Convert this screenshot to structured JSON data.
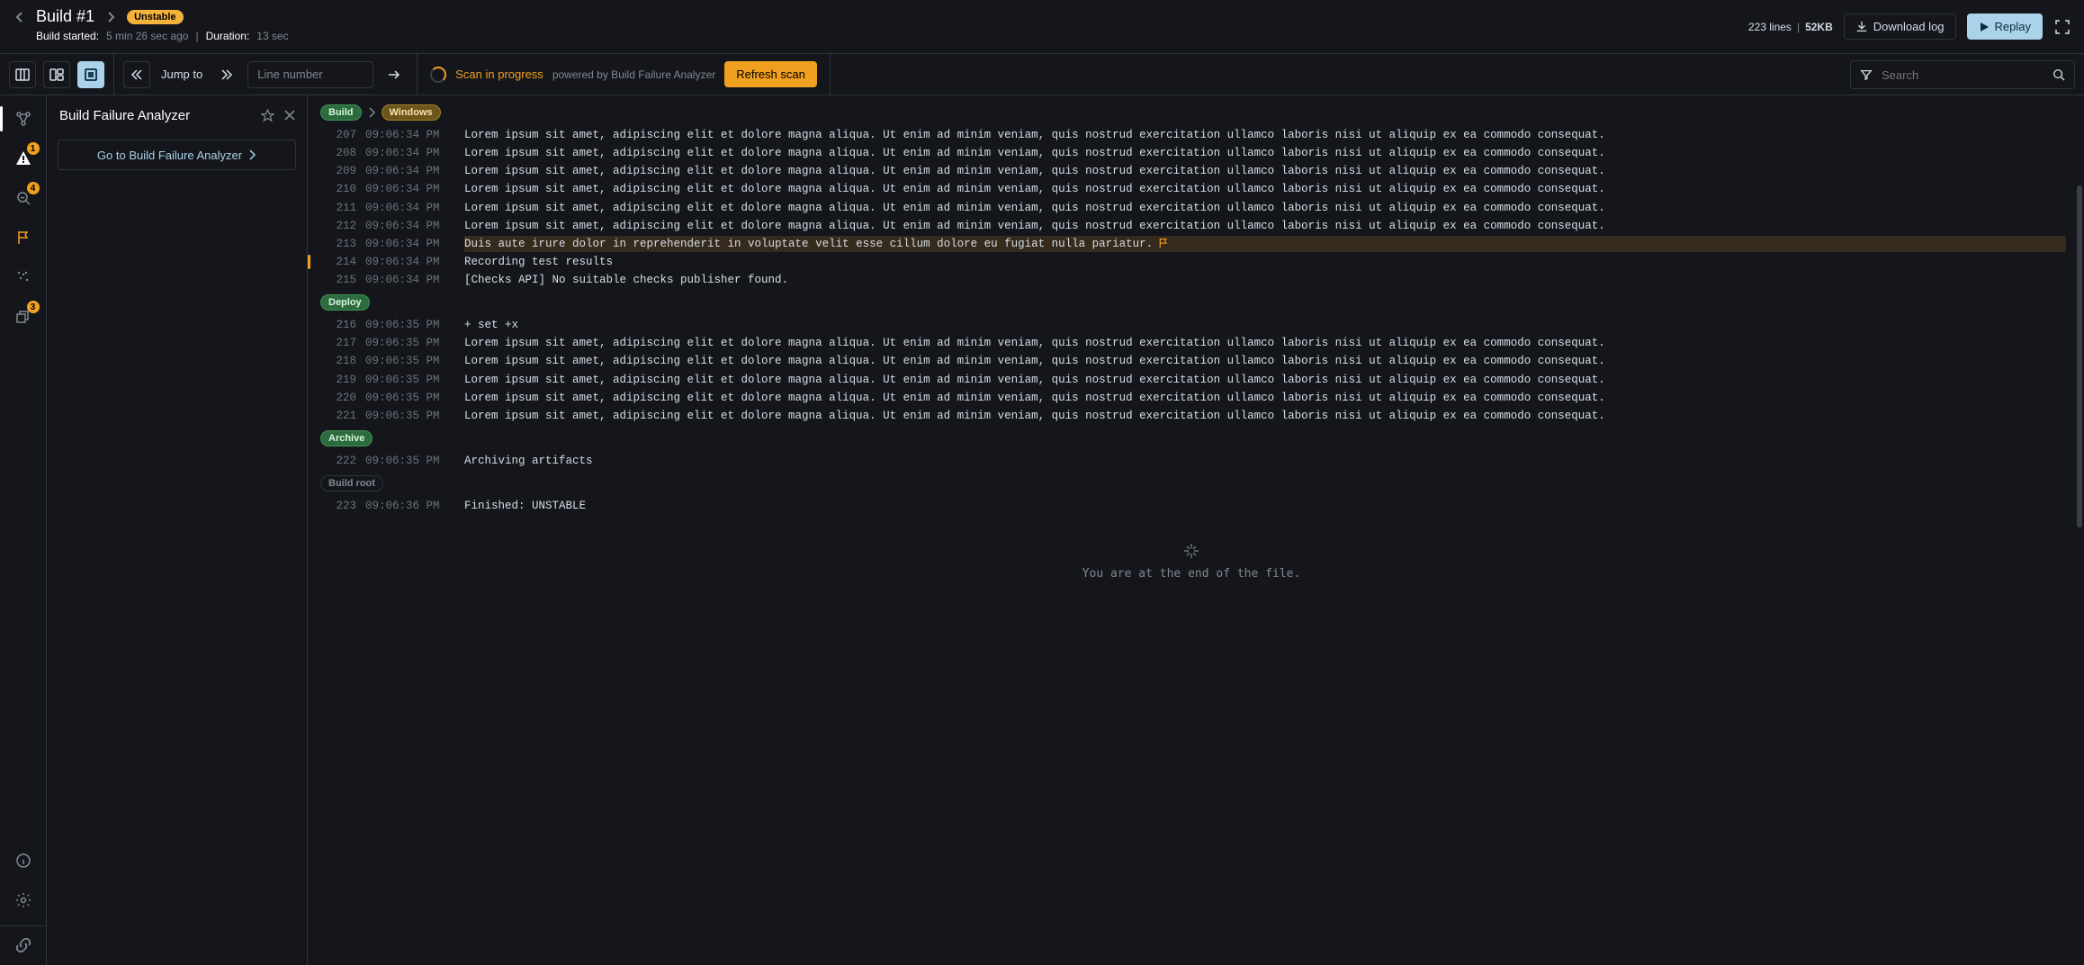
{
  "header": {
    "title": "Build #1",
    "status": "Unstable",
    "started_label": "Build started:",
    "started_value": "5 min 26 sec ago",
    "duration_label": "Duration:",
    "duration_value": "13 sec",
    "lines_text": "223 lines",
    "size_text": "52KB",
    "download_label": "Download log",
    "replay_label": "Replay"
  },
  "toolbar": {
    "jump_label": "Jump to",
    "line_placeholder": "Line number",
    "scan_title": "Scan in progress",
    "scan_sub": "powered by Build Failure Analyzer",
    "refresh_label": "Refresh scan",
    "search_placeholder": "Search"
  },
  "rail_badges": {
    "warnings": "1",
    "issues": "4",
    "stacks": "3"
  },
  "side_panel": {
    "title": "Build Failure Analyzer",
    "link_label": "Go to Build Failure Analyzer"
  },
  "ipsum": "Lorem ipsum sit amet, adipiscing elit et dolore magna aliqua. Ut enim ad minim veniam, quis nostrud exercitation ullamco laboris nisi ut aliquip ex ea commodo consequat.",
  "log_sections": [
    {
      "crumbs": [
        {
          "label": "Build",
          "kind": "green"
        },
        {
          "label": "Windows",
          "kind": "yellow"
        }
      ],
      "lines": [
        {
          "n": 207,
          "t": "09:06:34 PM",
          "key": "ipsum"
        },
        {
          "n": 208,
          "t": "09:06:34 PM",
          "key": "ipsum"
        },
        {
          "n": 209,
          "t": "09:06:34 PM",
          "key": "ipsum"
        },
        {
          "n": 210,
          "t": "09:06:34 PM",
          "key": "ipsum"
        },
        {
          "n": 211,
          "t": "09:06:34 PM",
          "key": "ipsum"
        },
        {
          "n": 212,
          "t": "09:06:34 PM",
          "key": "ipsum"
        },
        {
          "n": 213,
          "t": "09:06:34 PM",
          "text": "Duis aute irure dolor in reprehenderit in voluptate velit esse cillum dolore eu fugiat nulla pariatur.",
          "hl": true,
          "flag": true
        },
        {
          "n": 214,
          "t": "09:06:34 PM",
          "text": "Recording test results",
          "marker": true
        },
        {
          "n": 215,
          "t": "09:06:34 PM",
          "text": "[Checks API] No suitable checks publisher found."
        }
      ]
    },
    {
      "crumbs": [
        {
          "label": "Deploy",
          "kind": "green"
        }
      ],
      "lines": [
        {
          "n": 216,
          "t": "09:06:35 PM",
          "text": "+ set +x"
        },
        {
          "n": 217,
          "t": "09:06:35 PM",
          "key": "ipsum"
        },
        {
          "n": 218,
          "t": "09:06:35 PM",
          "key": "ipsum"
        },
        {
          "n": 219,
          "t": "09:06:35 PM",
          "key": "ipsum"
        },
        {
          "n": 220,
          "t": "09:06:35 PM",
          "key": "ipsum"
        },
        {
          "n": 221,
          "t": "09:06:35 PM",
          "key": "ipsum"
        }
      ]
    },
    {
      "crumbs": [
        {
          "label": "Archive",
          "kind": "green"
        }
      ],
      "lines": [
        {
          "n": 222,
          "t": "09:06:35 PM",
          "text": "Archiving artifacts"
        }
      ]
    },
    {
      "crumbs": [
        {
          "label": "Build root",
          "kind": "gray"
        }
      ],
      "lines": [
        {
          "n": 223,
          "t": "09:06:36 PM",
          "text": "Finished: UNSTABLE"
        }
      ]
    }
  ],
  "eof_text": "You are at the end of the file."
}
